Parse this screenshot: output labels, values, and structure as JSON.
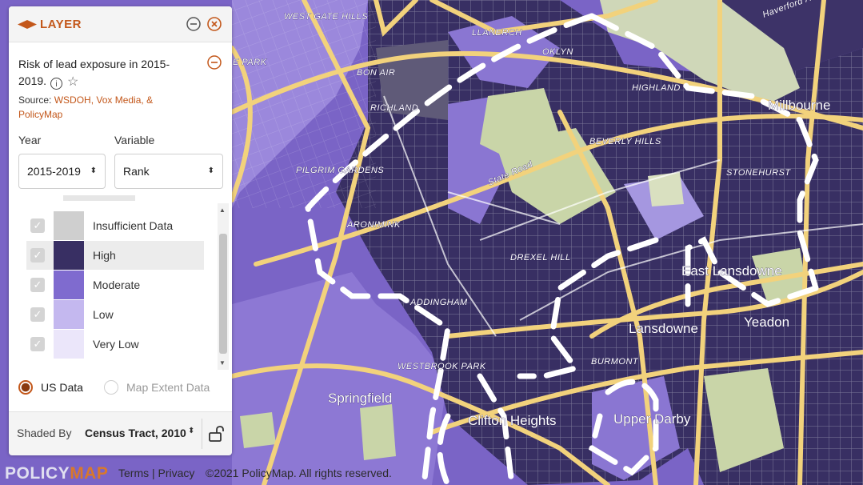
{
  "layer_panel": {
    "header_title": "LAYER",
    "layer_name": "Risk of lead exposure in 2015-2019.",
    "source_prefix": "Source: ",
    "source_link": "WSDOH, Vox Media, & PolicyMap",
    "year_label": "Year",
    "year_value": "2015-2019",
    "variable_label": "Variable",
    "variable_value": "Rank",
    "legend": [
      {
        "label": "Insufficient Data",
        "color": "#cfcfcf",
        "checked": true,
        "highlighted": false
      },
      {
        "label": "High",
        "color": "#382f63",
        "checked": true,
        "highlighted": true
      },
      {
        "label": "Moderate",
        "color": "#7f6bcf",
        "checked": true,
        "highlighted": false
      },
      {
        "label": "Low",
        "color": "#c4b8ef",
        "checked": true,
        "highlighted": false
      },
      {
        "label": "Very Low",
        "color": "#ebe6fa",
        "checked": true,
        "highlighted": false
      }
    ],
    "data_scope_options": [
      "US Data",
      "Map Extent Data"
    ],
    "data_scope_selected": "US Data",
    "shaded_by_label": "Shaded By",
    "shaded_by_value": "Census Tract, 2010"
  },
  "map": {
    "labels": {
      "west_gate_hills": "WEST GATE HILLS",
      "llanerch": "LLANERCH",
      "brooklyn": "OKLYN",
      "bon_air": "BON AIR",
      "richland": "RICHLAND",
      "highland": "HIGHLAND",
      "millbourne": "Millbourne",
      "park": "E PARK",
      "beverly_hills": "BEVERLY HILLS",
      "pilgrim_gardens": "PILGRIM GARDENS",
      "state_road": "State Road",
      "stonehurst": "STONEHURST",
      "aronimink": "ARONIMINK",
      "drexel_hill": "DREXEL HILL",
      "east_lansdowne": "East Lansdowne",
      "addingham": "ADDINGHAM",
      "lansdowne": "Lansdowne",
      "yeadon": "Yeadon",
      "burmont": "BURMONT",
      "westbrook_park": "WESTBROOK PARK",
      "springfield": "Springfield",
      "clifton_heights": "Clifton Heights",
      "upper_darby": "Upper Darby",
      "haverford": "Haverford Ave"
    }
  },
  "footer": {
    "logo_main": "POLICY",
    "logo_accent": "MAP",
    "links": "Terms | Privacy",
    "copyright": "©2021 PolicyMap. All rights reserved."
  },
  "colors": {
    "accent": "#c3571a",
    "high": "#382f63",
    "moderate": "#7f6bcf",
    "low": "#c4b8ef",
    "very_low": "#ebe6fa",
    "road": "#f2d27c"
  }
}
